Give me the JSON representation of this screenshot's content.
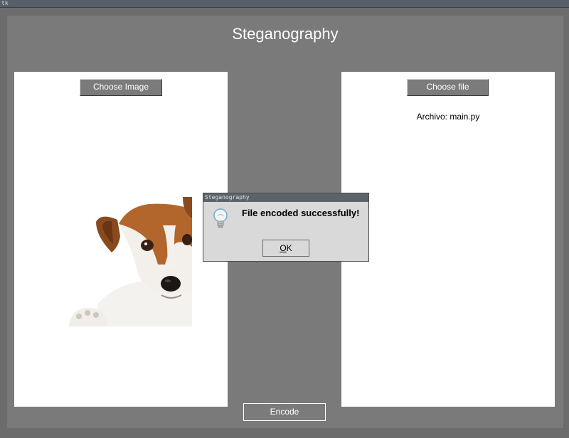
{
  "window": {
    "title": "tk"
  },
  "app": {
    "title": "Steganography",
    "choose_image_label": "Choose Image",
    "choose_file_label": "Choose file",
    "file_info": "Archivo: main.py",
    "encode_label": "Encode"
  },
  "dialog": {
    "title": "Steganography",
    "message": "File encoded successfully!",
    "ok_label": "K",
    "ok_mnemonic": "O",
    "icon": "lightbulb-icon"
  },
  "colors": {
    "background": "#7a7a7a",
    "button": "#7b7b7b",
    "panel": "#ffffff",
    "dialog": "#d9d9d9"
  }
}
